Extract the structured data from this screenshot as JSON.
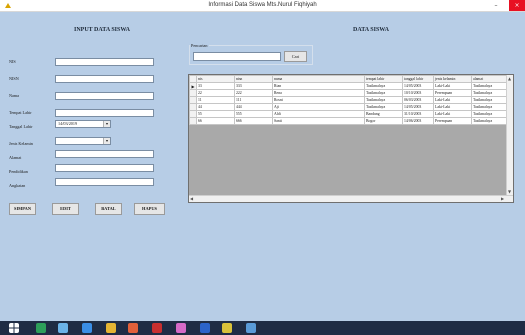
{
  "window": {
    "title": "Informasi Data Siswa Mts.Nurul Fiqhiyah",
    "minimize_glyph": "–",
    "close_glyph": "×"
  },
  "form": {
    "heading": "INPUT DATA SISWA",
    "nis_label": "NIS",
    "nisn_label": "NISN",
    "nama_label": "Nama",
    "tempat_lahir_label": "Tempat Lahir",
    "tanggal_lahir_label": "Tanggal Lahir",
    "tanggal_lahir_value": "14/03/2019",
    "jenis_kelamin_label": "Jenis Kelamin",
    "alamat_label": "Alamat",
    "pendidikan_label": "Pendidikan",
    "angkatan_label": "Angkatan",
    "nis_value": "",
    "nisn_value": "",
    "nama_value": "",
    "tempat_lahir_value": "",
    "jenis_kelamin_value": "",
    "alamat_value": "",
    "pendidikan_value": "",
    "angkatan_value": ""
  },
  "buttons": {
    "simpan": "SIMPAN",
    "edit": "EDIT",
    "batal": "BATAL",
    "hapus": "HAPUS"
  },
  "data_panel": {
    "heading": "DATA SISWA",
    "search_group_label": "Pencarian",
    "search_value": "",
    "search_button": "Cari"
  },
  "table": {
    "columns": [
      "nis",
      "nisn",
      "nama",
      "tempat lahir",
      "tanggal lahir",
      "jenis kelamin",
      "alamat"
    ],
    "rows": [
      [
        "33",
        "333",
        "Rian",
        "Tasikmalaya",
        "14/05/2003",
        "Laki-Laki",
        "Tasikmalaya"
      ],
      [
        "22",
        "222",
        "Rena",
        "Tasikmalaya",
        "10/10/2003",
        "Perempuan",
        "Tasikmalaya"
      ],
      [
        "11",
        "111",
        "Rosni",
        "Tasikmalaya",
        "06/03/2003",
        "Laki-Laki",
        "Tasikmalaya"
      ],
      [
        "44",
        "444",
        "Aji",
        "Tasikmalaya",
        "14/05/2003",
        "Laki-Laki",
        "Tasikmalaya"
      ],
      [
        "55",
        "555",
        "Aldi",
        "Bandung",
        "31/10/2003",
        "Laki-Laki",
        "Tasikmalaya"
      ],
      [
        "66",
        "666",
        "Santi",
        "Bogor",
        "14/06/2003",
        "Perempuan",
        "Tasikmalaya"
      ]
    ],
    "current_row_marker": "▶"
  },
  "colors": {
    "form_background": "#b7cde6",
    "close_button": "#e81123",
    "taskbar": "#1f2c44"
  },
  "icons": {
    "app": "app-icon",
    "combo_arrow": "chevron-down-icon",
    "taskbar": [
      "windows-start-icon",
      "file-explorer-icon",
      "store-icon",
      "edge-icon",
      "folder-icon",
      "office-icon",
      "app-icon",
      "paint-icon",
      "word-icon",
      "sketch-icon",
      "notepad-icon"
    ]
  }
}
